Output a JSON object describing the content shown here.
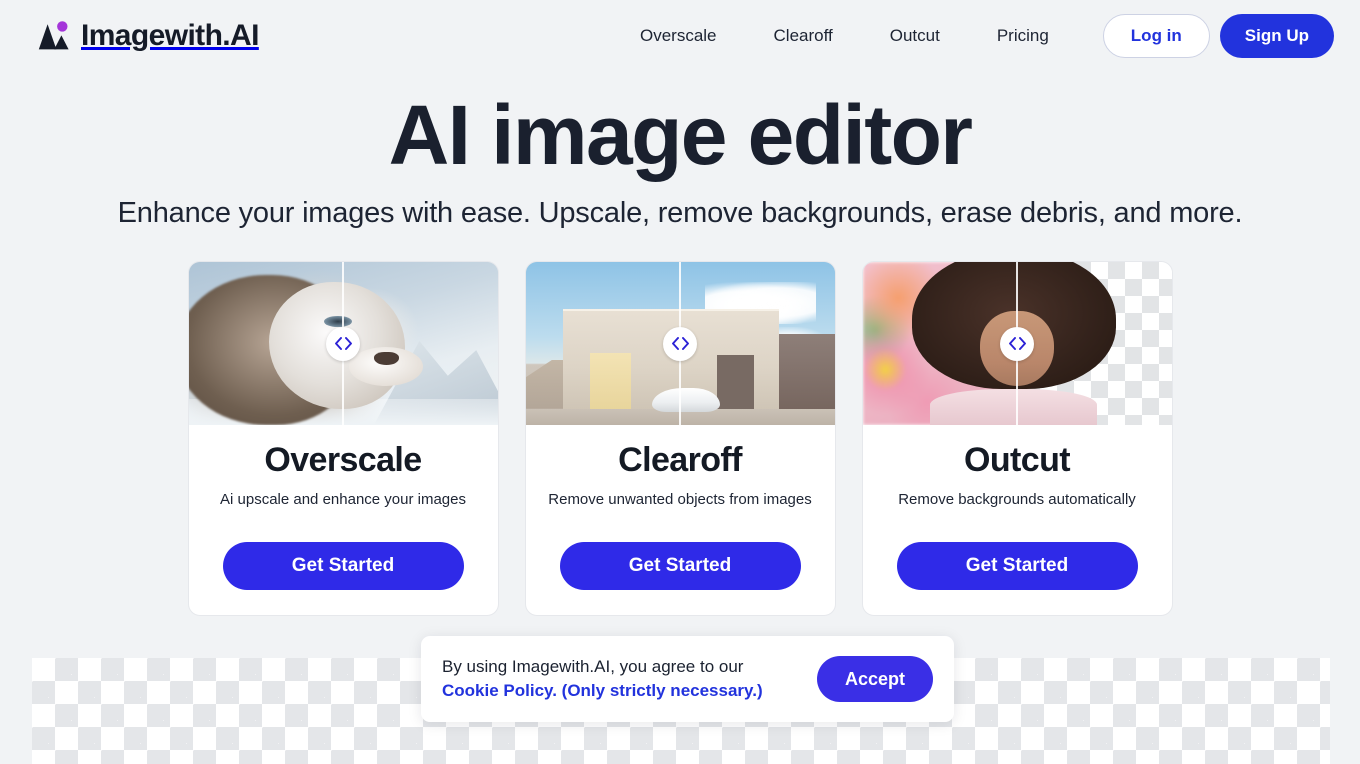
{
  "brand": {
    "name": "Imagewith.AI",
    "logo_icon": "mountain-peaks-icon",
    "accent_purple": "#a435d9",
    "logo_dark": "#151b28"
  },
  "colors": {
    "page_background": "#f1f3f5",
    "primary_blue": "#2233dd",
    "button_blue": "#2f2ae8",
    "text_dark": "#151b28",
    "card_white": "#ffffff",
    "checker_gray": "#e4e6e9"
  },
  "nav": {
    "items": [
      {
        "label": "Overscale"
      },
      {
        "label": "Clearoff"
      },
      {
        "label": "Outcut"
      },
      {
        "label": "Pricing"
      }
    ]
  },
  "auth": {
    "login_label": "Log in",
    "signup_label": "Sign Up"
  },
  "hero": {
    "title": "AI image editor",
    "subtitle": "Enhance your images with ease. Upscale, remove backgrounds, erase debris, and more."
  },
  "cards": [
    {
      "title": "Overscale",
      "description": "Ai upscale and enhance your images",
      "cta_label": "Get Started",
      "preview": "lion-before-after-comparison",
      "handle_icon": "left-right-chevrons-icon"
    },
    {
      "title": "Clearoff",
      "description": "Remove unwanted objects from images",
      "cta_label": "Get Started",
      "preview": "building-before-after-comparison",
      "handle_icon": "left-right-chevrons-icon"
    },
    {
      "title": "Outcut",
      "description": "Remove backgrounds automatically",
      "cta_label": "Get Started",
      "preview": "portrait-before-after-comparison",
      "handle_icon": "left-right-chevrons-icon"
    }
  ],
  "cookie_banner": {
    "text_before": "By using Imagewith.AI, you agree to our ",
    "link_label": "Cookie Policy. (Only strictly necessary.)",
    "accept_label": "Accept"
  }
}
